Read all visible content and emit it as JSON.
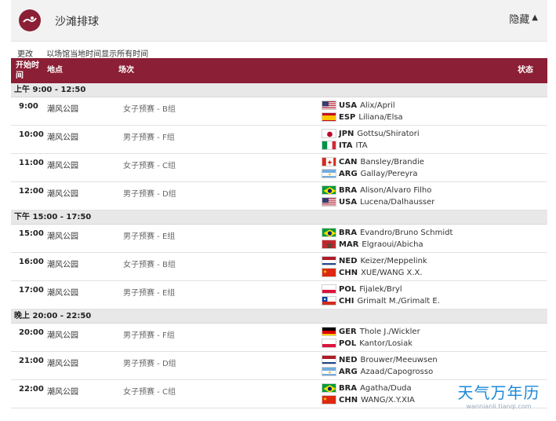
{
  "header": {
    "title": "沙滩排球",
    "hide_label": "隐藏"
  },
  "subbar": {
    "change_label": "更改",
    "timezone_note": "以场馆当地时间显示所有时间"
  },
  "table": {
    "columns": {
      "start_time": "开始时间",
      "venue": "地点",
      "event": "场次",
      "status": "状态"
    },
    "sections": [
      {
        "label": "上午  9:00 - 12:50",
        "rows": [
          {
            "time": "9:00",
            "venue": "潮风公园",
            "event": "女子预赛 - B组",
            "team1": {
              "flag": "usa",
              "code": "USA",
              "names": "Alix/April"
            },
            "team2": {
              "flag": "esp",
              "code": "ESP",
              "names": "Liliana/Elsa"
            }
          },
          {
            "time": "10:00",
            "venue": "潮风公园",
            "event": "男子预赛 - F组",
            "team1": {
              "flag": "jpn",
              "code": "JPN",
              "names": "Gottsu/Shiratori"
            },
            "team2": {
              "flag": "ita",
              "code": "ITA",
              "names": "ITA"
            }
          },
          {
            "time": "11:00",
            "venue": "潮风公园",
            "event": "女子预赛 - C组",
            "team1": {
              "flag": "can",
              "code": "CAN",
              "names": "Bansley/Brandie"
            },
            "team2": {
              "flag": "arg",
              "code": "ARG",
              "names": "Gallay/Pereyra"
            }
          },
          {
            "time": "12:00",
            "venue": "潮风公园",
            "event": "男子预赛 - D组",
            "team1": {
              "flag": "bra",
              "code": "BRA",
              "names": "Alison/Alvaro Filho"
            },
            "team2": {
              "flag": "usa",
              "code": "USA",
              "names": "Lucena/Dalhausser"
            }
          }
        ]
      },
      {
        "label": "下午  15:00 - 17:50",
        "rows": [
          {
            "time": "15:00",
            "venue": "潮风公园",
            "event": "男子预赛 - E组",
            "team1": {
              "flag": "bra",
              "code": "BRA",
              "names": "Evandro/Bruno Schmidt"
            },
            "team2": {
              "flag": "mar",
              "code": "MAR",
              "names": "Elgraoui/Abicha"
            }
          },
          {
            "time": "16:00",
            "venue": "潮风公园",
            "event": "女子预赛 - B组",
            "team1": {
              "flag": "ned",
              "code": "NED",
              "names": "Keizer/Meppelink"
            },
            "team2": {
              "flag": "chn",
              "code": "CHN",
              "names": "XUE/WANG X.X."
            }
          },
          {
            "time": "17:00",
            "venue": "潮风公园",
            "event": "男子预赛 - E组",
            "team1": {
              "flag": "pol",
              "code": "POL",
              "names": "Fijalek/Bryl"
            },
            "team2": {
              "flag": "chi",
              "code": "CHI",
              "names": "Grimalt M./Grimalt E."
            }
          }
        ]
      },
      {
        "label": "晚上  20:00 - 22:50",
        "rows": [
          {
            "time": "20:00",
            "venue": "潮风公园",
            "event": "男子预赛 - F组",
            "team1": {
              "flag": "ger",
              "code": "GER",
              "names": "Thole J./Wickler"
            },
            "team2": {
              "flag": "pol",
              "code": "POL",
              "names": "Kantor/Losiak"
            }
          },
          {
            "time": "21:00",
            "venue": "潮风公园",
            "event": "男子预赛 - D组",
            "team1": {
              "flag": "ned",
              "code": "NED",
              "names": "Brouwer/Meeuwsen"
            },
            "team2": {
              "flag": "arg",
              "code": "ARG",
              "names": "Azaad/Capogrosso"
            }
          },
          {
            "time": "22:00",
            "venue": "潮风公园",
            "event": "女子预赛 - C组",
            "team1": {
              "flag": "bra",
              "code": "BRA",
              "names": "Agatha/Duda"
            },
            "team2": {
              "flag": "chn",
              "code": "CHN",
              "names": "WANG/X.Y.XIA"
            }
          }
        ]
      }
    ]
  },
  "watermark": {
    "brand": "天气万年历",
    "url": "wannianli.tianqi.com"
  },
  "colors": {
    "header_bg": "#8b1f35",
    "section_bg": "#e8e8e8",
    "topbar_bg": "#f2f2f2",
    "watermark": "#1b88d8"
  }
}
